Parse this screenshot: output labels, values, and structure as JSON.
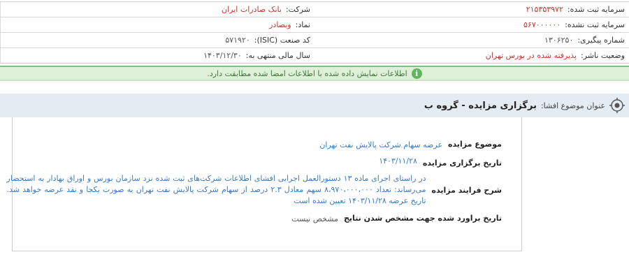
{
  "info": {
    "company_label": "شرکت:",
    "company_value": "بانک صادرات ایران",
    "capital_label": "سرمایه ثبت شده:",
    "capital_value": "۲۱۵۳۵۳۹۷۲",
    "symbol_label": "نماد:",
    "symbol_value": "وبصادر",
    "unregistered_label": "سرمایه ثبت نشده:",
    "unregistered_value": "۵۶۷۰۰۰۰۰۰",
    "isic_label": "کد صنعت (ISIC):",
    "isic_value": "۵۷۱۹۲۰",
    "tracking_label": "شماره پیگیری:",
    "tracking_value": "۱۳۰۶۲۵۰",
    "fiscal_label": "سال مالی منتهی به:",
    "fiscal_value": "۱۴۰۳/۱۲/۳۰",
    "status_label": "وضعیت ناشر:",
    "status_value": "پذیرفته شده در بورس تهران"
  },
  "notice": {
    "icon": "i",
    "text": "اطلاعات نمایش داده شده با اطلاعات امضا شده مطابقت دارد."
  },
  "title": {
    "label": "عنوان موضوع افشا:",
    "value": "برگزاری مزایده - گروه ب"
  },
  "details": {
    "subject_label": "موضوع مزایده",
    "subject_value": "عرضه سهام شرکت پالایش نفت تهران",
    "date_label": "تاریخ برگزاری مزایده",
    "date_value": "۱۴۰۳/۱۱/۲۸",
    "process_label": "شرح فرایند مزایده",
    "process_value": "در راستای اجرای ماده ۱۳ دستورالعمل اجرایی افشای اطلاعات شرکت‌های ثبت شده نزد سازمان بورس و اوراق بهادار به استحضار می‌رساند: تعداد ۸،۹۷۰،۰۰۰،۰۰۰ سهم معادل ۲.۳ درصد از سهام شرکت پالایش نفت تهران به صورت یکجا و نقد عرضه خواهد شد. تاریخ عرضه ۱۴۰۳/۱۱/۲۸ تعیین شده است",
    "estimate_label": "تاریخ براورد شده جهت مشخص شدن نتایج",
    "estimate_value": "مشخص نیست"
  }
}
